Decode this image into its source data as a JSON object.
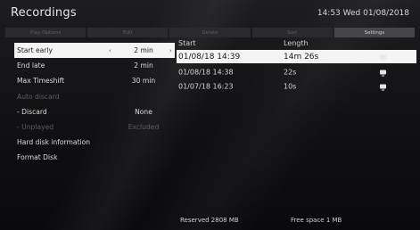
{
  "header": {
    "title": "Recordings",
    "clock": "14:53 Wed 01/08/2018"
  },
  "tabs": [
    {
      "label": "Play Options",
      "active": false
    },
    {
      "label": "Edit",
      "active": false
    },
    {
      "label": "Delete",
      "active": false
    },
    {
      "label": "Sort",
      "active": false
    },
    {
      "label": "Settings",
      "active": true
    }
  ],
  "settings_menu": [
    {
      "label": "Start early",
      "value": "2 min",
      "selected": true,
      "disabled": false,
      "has_arrows": true
    },
    {
      "label": "End late",
      "value": "2 min",
      "selected": false,
      "disabled": false,
      "has_arrows": false
    },
    {
      "label": "Max Timeshift",
      "value": "30 min",
      "selected": false,
      "disabled": false,
      "has_arrows": false
    },
    {
      "label": "Auto discard",
      "value": "",
      "selected": false,
      "disabled": true,
      "has_arrows": false
    },
    {
      "label": "- Discard",
      "value": "None",
      "selected": false,
      "disabled": false,
      "has_arrows": false
    },
    {
      "label": "- Unplayed",
      "value": "Excluded",
      "selected": false,
      "disabled": true,
      "has_arrows": false
    },
    {
      "label": "Hard disk information",
      "value": "",
      "selected": false,
      "disabled": false,
      "has_arrows": false
    },
    {
      "label": "Format Disk",
      "value": "",
      "selected": false,
      "disabled": false,
      "has_arrows": false
    }
  ],
  "arrows": {
    "left": "‹",
    "right": "›"
  },
  "recordings": {
    "columns": {
      "start": "Start",
      "length": "Length"
    },
    "rows": [
      {
        "start": "01/08/18  14:39",
        "length": "14m 26s",
        "icon": "message-icon",
        "selected": true
      },
      {
        "start": "01/08/18  14:38",
        "length": "22s",
        "icon": "message-icon",
        "selected": false
      },
      {
        "start": "01/07/18  16:23",
        "length": "10s",
        "icon": "message-icon",
        "selected": false
      }
    ]
  },
  "footer": {
    "reserved": "Reserved  2808 MB",
    "free": "Free space  1 MB"
  }
}
